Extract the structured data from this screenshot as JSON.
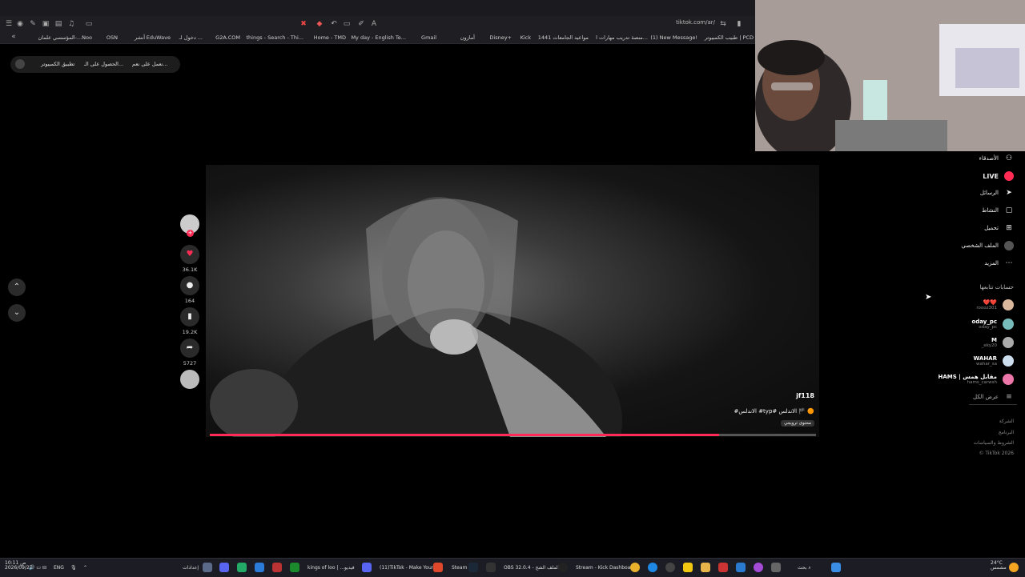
{
  "browser": {
    "url": "tiktok.com/ar/",
    "bookmarks": [
      "طبيب الكمبيوتر | PCD",
      "(1) New Message!",
      "منصة تدريب مهارات ا...",
      "مواعيد الجامعات 1441",
      "Kick",
      "Disney+",
      "أمازون",
      "Gmail",
      "My day - English Te...",
      "Home - TMD",
      "things - Search - Thi...",
      "G2A.COM",
      "دخول لـ ...",
      "EduWave",
      "أنشر",
      "OSN",
      "المؤسسي علمان-...Noo"
    ]
  },
  "top_bar": {
    "item1": "نعمل على نعم...",
    "item2": "الحصول على الـ...",
    "item3": "تطبيق الكمبيوتر"
  },
  "video": {
    "author": "jf118",
    "caption": "#الاندلس #typ# الاندلس 🏴 🟠",
    "tag": "محتوى ترويجي",
    "progress": 0.84
  },
  "actions": {
    "likes": "36.1K",
    "comments": "164",
    "saves": "19.2K",
    "shares": "5727"
  },
  "sidebar": {
    "items": [
      "الأصدقاء",
      "LIVE",
      "الرسائل",
      "النشاط",
      "تحميل",
      "الملف الشخصي",
      "المزيد"
    ],
    "following_title": "حسابات تتابعها",
    "accounts": [
      {
        "name": "❤️❤️",
        "handle": "roooz301"
      },
      {
        "name": "oday_pc",
        "handle": "oday_pc"
      },
      {
        "name": "M",
        "handle": "_eky20"
      },
      {
        "name": "WAHAR",
        "handle": "wahar_sa"
      },
      {
        "name": "HAMS | مقابل همس",
        "handle": "hams_carwsh"
      }
    ],
    "see_more": "عرض الكل",
    "footer": [
      "الشركة",
      "البرنامج",
      "الشروط والسياسات",
      "© TikTok 2026"
    ]
  },
  "taskbar": {
    "settings": "إعدادات",
    "apps": [
      "kings of loo | ...فيديو",
      "(11)TikTok - Make Your D",
      "Steam",
      "OBS 32.0.4 - الملف الشخ",
      "Stream - Kick Dashboar"
    ],
    "search": "بحث",
    "lang": "ENG",
    "time": "10:11 ص",
    "date": "2026/09/27",
    "weather_temp": "24°C",
    "weather_desc": "مشمس"
  },
  "colors": {
    "accent": "#fe2c55"
  }
}
